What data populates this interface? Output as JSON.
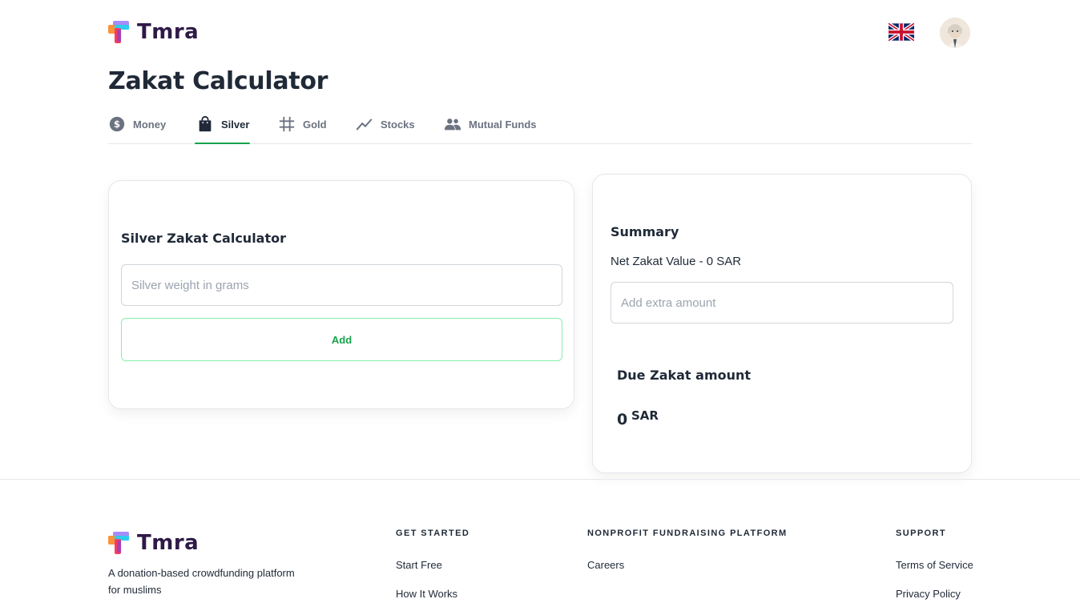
{
  "brand": {
    "name": "Tmra"
  },
  "header": {
    "language_flag": "uk-flag-icon",
    "avatar": "user-avatar"
  },
  "page": {
    "title": "Zakat Calculator"
  },
  "tabs": [
    {
      "label": "Money",
      "icon": "dollar-circle-icon",
      "active": false
    },
    {
      "label": "Silver",
      "icon": "shopping-bag-icon",
      "active": true
    },
    {
      "label": "Gold",
      "icon": "hash-grid-icon",
      "active": false
    },
    {
      "label": "Stocks",
      "icon": "trending-line-icon",
      "active": false
    },
    {
      "label": "Mutual Funds",
      "icon": "people-icon",
      "active": false
    }
  ],
  "calculator": {
    "title": "Silver Zakat Calculator",
    "weight_placeholder": "Silver weight in grams",
    "weight_value": "",
    "add_label": "Add"
  },
  "summary": {
    "title": "Summary",
    "net_value_text": "Net Zakat Value - 0 SAR",
    "extra_placeholder": "Add extra amount",
    "extra_value": "",
    "due_title": "Due Zakat amount",
    "due_amount": "0",
    "due_currency": "SAR"
  },
  "footer": {
    "description": "A donation-based crowdfunding platform for muslims",
    "columns": [
      {
        "heading": "GET STARTED",
        "links": [
          "Start Free",
          "How It Works"
        ]
      },
      {
        "heading": "NONPROFIT FUNDRAISING PLATFORM",
        "links": [
          "Careers"
        ]
      },
      {
        "heading": "SUPPORT",
        "links": [
          "Terms of Service",
          "Privacy Policy"
        ]
      }
    ]
  },
  "colors": {
    "accent": "#16a34a",
    "text": "#1f2937",
    "muted": "#6b7280",
    "brand_text": "#2e1a47"
  }
}
